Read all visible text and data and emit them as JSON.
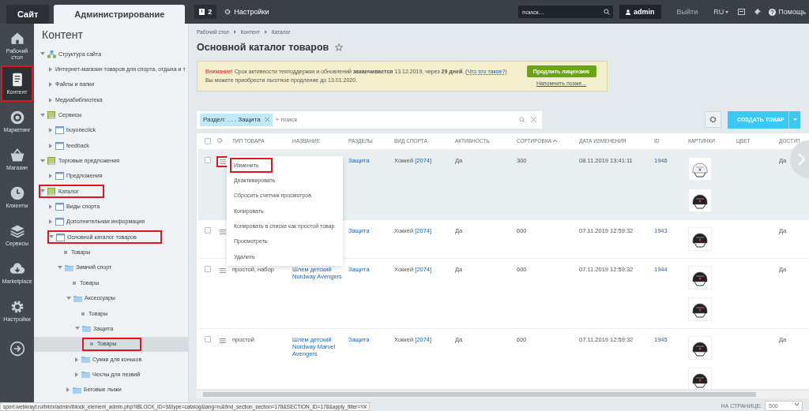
{
  "topbar": {
    "tabs": [
      {
        "label": "Сайт",
        "selected": false
      },
      {
        "label": "Администрирование",
        "selected": true
      }
    ],
    "notifications": "2",
    "settings": "Настройки",
    "search": {
      "placeholder": "поиск..."
    },
    "user": "admin",
    "logout": "Выйти",
    "language": "RU",
    "help": "Помощь"
  },
  "nav": [
    {
      "label": "Рабочий стол",
      "selected": false,
      "highlighted": false
    },
    {
      "label": "Контент",
      "selected": true,
      "highlighted": true
    },
    {
      "label": "Маркетинг",
      "selected": false,
      "highlighted": false
    },
    {
      "label": "Магазин",
      "selected": false,
      "highlighted": false
    },
    {
      "label": "Клиенты",
      "selected": false,
      "highlighted": false
    },
    {
      "label": "Сервисы",
      "selected": false,
      "highlighted": false
    },
    {
      "label": "Marketplace",
      "selected": false,
      "highlighted": false
    },
    {
      "label": "Настройки",
      "selected": false,
      "highlighted": false
    },
    {
      "selected": false,
      "highlighted": false
    }
  ],
  "tree": {
    "title": "Контент",
    "items": [
      {
        "label": "Структура сайта",
        "kind": "site",
        "expanded": true,
        "selected": false,
        "highlighted": false,
        "children": [
          {
            "label": "Интернет-магазин товаров для спорта, отдыха и т",
            "kind": "page",
            "expanded": false,
            "selected": false,
            "highlighted": false
          },
          {
            "label": "Файлы и папки",
            "kind": "page",
            "expanded": false,
            "selected": false,
            "highlighted": false
          },
          {
            "label": "Медиабиблиотека",
            "kind": "page",
            "expanded": false,
            "selected": false,
            "highlighted": false
          }
        ]
      },
      {
        "label": "Сервисы",
        "kind": "group",
        "expanded": true,
        "selected": false,
        "highlighted": false,
        "children": [
          {
            "label": "buyoneclick",
            "kind": "iblock",
            "expanded": false,
            "selected": false,
            "highlighted": false
          },
          {
            "label": "feedback",
            "kind": "iblock",
            "expanded": false,
            "selected": false,
            "highlighted": false
          }
        ]
      },
      {
        "label": "Торговые предложения",
        "kind": "group",
        "expanded": true,
        "selected": false,
        "highlighted": false,
        "children": [
          {
            "label": "Предложения",
            "kind": "iblock",
            "expanded": false,
            "selected": false,
            "highlighted": false
          }
        ]
      },
      {
        "label": "Каталог",
        "kind": "group",
        "expanded": true,
        "selected": false,
        "highlighted": true,
        "children": [
          {
            "label": "Виды спорта",
            "kind": "iblock",
            "expanded": false,
            "selected": false,
            "highlighted": false
          },
          {
            "label": "Дополнительная информация",
            "kind": "iblock",
            "expanded": false,
            "selected": false,
            "highlighted": false
          },
          {
            "label": "Основной каталог товаров",
            "kind": "iblock",
            "expanded": true,
            "selected": false,
            "highlighted": true,
            "children": [
              {
                "label": "Товары",
                "kind": "bullet",
                "selected": false,
                "highlighted": false
              },
              {
                "label": "Зимний спорт",
                "kind": "folder",
                "expanded": true,
                "selected": false,
                "highlighted": false,
                "children": [
                  {
                    "label": "Товары",
                    "kind": "bullet",
                    "selected": false,
                    "highlighted": false
                  },
                  {
                    "label": "Аксессуары",
                    "kind": "folder",
                    "expanded": true,
                    "selected": false,
                    "highlighted": false,
                    "children": [
                      {
                        "label": "Товары",
                        "kind": "bullet",
                        "selected": false,
                        "highlighted": false
                      },
                      {
                        "label": "Защита",
                        "kind": "folder",
                        "expanded": true,
                        "selected": false,
                        "highlighted": false,
                        "children": [
                          {
                            "label": "Товары",
                            "kind": "bullet",
                            "selected": true,
                            "highlighted": true
                          }
                        ]
                      },
                      {
                        "label": "Сумки для коньков",
                        "kind": "folder",
                        "expanded": false,
                        "selected": false,
                        "highlighted": false
                      },
                      {
                        "label": "Чехлы для лезвий",
                        "kind": "folder",
                        "expanded": false,
                        "selected": false,
                        "highlighted": false
                      }
                    ]
                  },
                  {
                    "label": "Беговые лыжи",
                    "kind": "folder",
                    "expanded": false,
                    "selected": false,
                    "highlighted": false
                  }
                ]
              }
            ]
          }
        ]
      }
    ]
  },
  "breadcrumbs": [
    "Рабочий стол",
    "Контент",
    "Каталог"
  ],
  "title": "Основной каталог товаров",
  "notice": {
    "label": "Внимание!",
    "text": "Срок активности техподдержки и обновлений **заканчивается** 13.12.2019, через **29 дней**. (",
    "link": "Что это такое?",
    "text_after": ")",
    "line2": "Вы можете приобрести льготное продление до 13.01.2020.",
    "button": "Продлить лицензию",
    "remind": "Напомнить позже..."
  },
  "filter": {
    "chip": "Раздел: . . . Защита",
    "placeholder": "+ поиск"
  },
  "create_button": "СОЗДАТЬ ТОВАР",
  "table": {
    "all_checked": false,
    "columns": [
      {
        "label": "ТИП ТОВАРА",
        "sorted": false
      },
      {
        "label": "НАЗВАНИЕ",
        "sorted": false
      },
      {
        "label": "РАЗДЕЛЫ",
        "sorted": false
      },
      {
        "label": "ВИД СПОРТА",
        "sorted": false
      },
      {
        "label": "АКТИВНОСТЬ",
        "sorted": false
      },
      {
        "label": "СОРТИРОВКА",
        "sorted": true
      },
      {
        "label": "ДАТА ИЗМЕНЕНИЯ",
        "sorted": false
      },
      {
        "label": "ID",
        "sorted": false
      },
      {
        "label": "КАРТИНКИ",
        "sorted": false
      },
      {
        "label": "ЦВЕТ",
        "sorted": false
      },
      {
        "label": "ДОСТУП",
        "sorted": false
      }
    ],
    "rows": [
      {
        "selected": true,
        "checked": false,
        "menu_highlighted": true,
        "section": "Защита",
        "sport": "Хоккей",
        "sport_code": "[2074]",
        "active": "Да",
        "sort": "300",
        "date": "08.11.2019 13:41:11",
        "id": "1946",
        "access": "Да"
      },
      {
        "selected": false,
        "checked": false,
        "menu_highlighted": false,
        "section": "Защита",
        "sport": "Хоккей",
        "sport_code": "[2074]",
        "active": "Да",
        "sort": "600",
        "date": "07.11.2019 12:59:32",
        "id": "1943",
        "access": "Да"
      },
      {
        "selected": false,
        "checked": false,
        "menu_highlighted": false,
        "type": "простой, набор",
        "name": "Шлем детский Nordway Avengers",
        "section": "Защита",
        "sport": "Хоккей",
        "sport_code": "[2074]",
        "active": "Да",
        "sort": "600",
        "date": "07.11.2019 12:59:32",
        "id": "1944",
        "access": "Да"
      },
      {
        "selected": false,
        "checked": false,
        "menu_highlighted": false,
        "type": "простой",
        "name": "Шлем детский Nordway Marvel Avengers",
        "section": "Защита",
        "sport": "Хоккей",
        "sport_code": "[2074]",
        "active": "Да",
        "sort": "600",
        "date": "07.11.2019 12:59:32",
        "id": "1945",
        "access": "Да"
      }
    ]
  },
  "context_menu": [
    {
      "label": "Изменить",
      "highlighted": true
    },
    {
      "label": "Деактивировать",
      "highlighted": false
    },
    {
      "label": "Сбросить счетчик просмотров",
      "highlighted": false
    },
    {
      "label": "Копировать",
      "highlighted": false
    },
    {
      "label": "Копировать в списке как простой товар",
      "highlighted": false
    },
    {
      "label": "Просмотреть",
      "highlighted": false
    },
    {
      "label": "Удалить",
      "highlighted": false
    }
  ],
  "pager": {
    "label": "НА СТРАНИЦЕ:",
    "value": "500"
  },
  "status_url": "sport.webkrayt.ru/bitrix/admin/iblock_element_admin.php?IBLOCK_ID=9&type=catalog&lang=ru&find_section_section=178&SECTION_ID=178&apply_filter=Y#"
}
